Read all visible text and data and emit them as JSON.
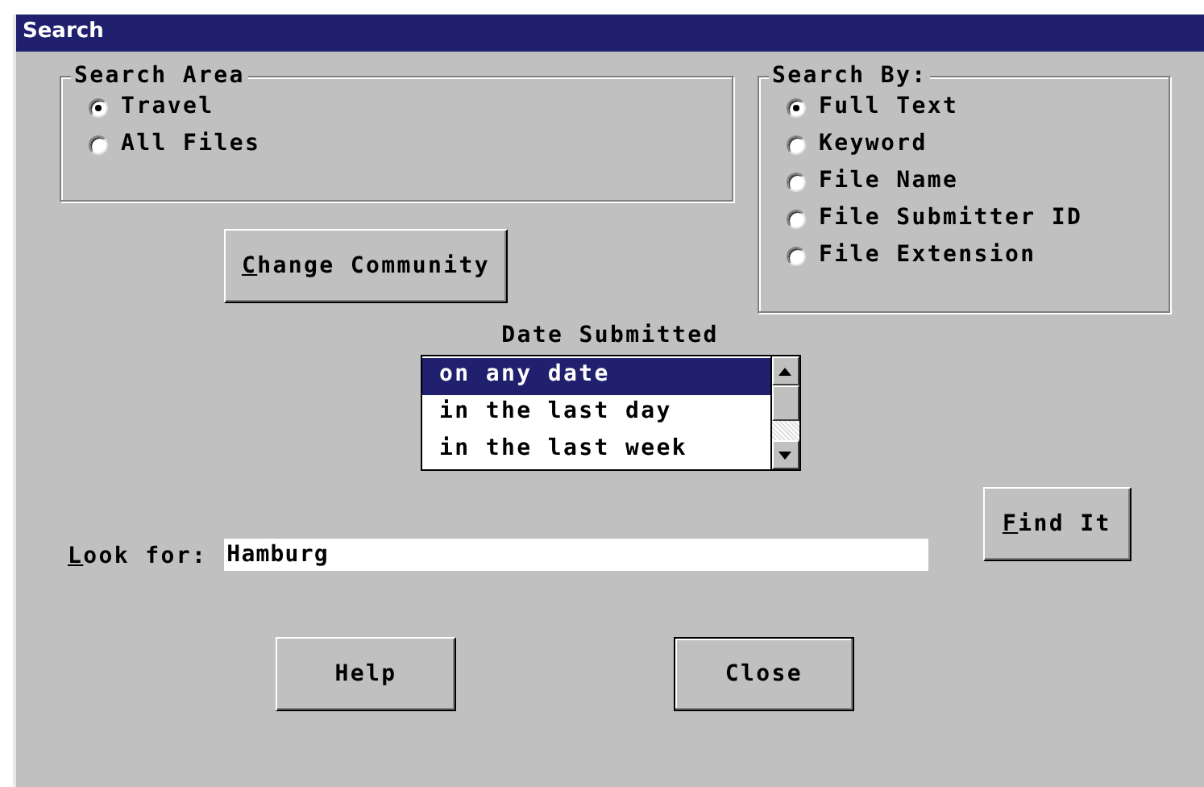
{
  "window": {
    "title": "Search"
  },
  "search_area": {
    "title": "Search Area",
    "options": [
      {
        "label": "Travel",
        "selected": true
      },
      {
        "label": "All Files",
        "selected": false
      }
    ]
  },
  "search_by": {
    "title": "Search By:",
    "options": [
      {
        "label": "Full Text",
        "selected": true
      },
      {
        "label": "Keyword",
        "selected": false
      },
      {
        "label": "File Name",
        "selected": false
      },
      {
        "label": "File Submitter ID",
        "selected": false
      },
      {
        "label": "File Extension",
        "selected": false
      }
    ]
  },
  "change_community_button": {
    "label": "Change Community",
    "mnemonic_underlined": true
  },
  "date_submitted": {
    "label": "Date Submitted",
    "items": [
      {
        "label": "on any date",
        "selected": true
      },
      {
        "label": "in the last day",
        "selected": false
      },
      {
        "label": "in the last week",
        "selected": false
      }
    ]
  },
  "look_for": {
    "label": "Look for:",
    "mnemonic_underlined": true,
    "value": "Hamburg"
  },
  "find_button": {
    "label": "Find It",
    "mnemonic_underlined": true
  },
  "buttons": [
    {
      "label": "Help",
      "default": false
    },
    {
      "label": "Close",
      "default": true
    }
  ]
}
